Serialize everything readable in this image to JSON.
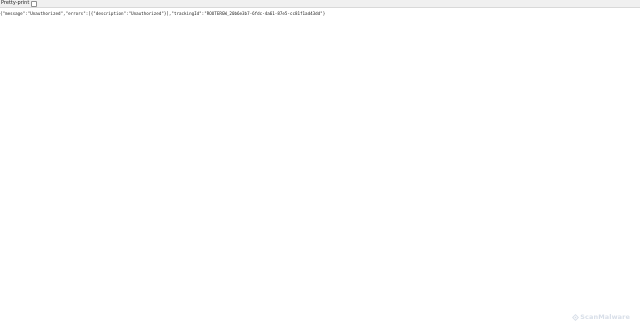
{
  "toolbar": {
    "pretty_print_label": "Pretty-print",
    "pretty_print_checked": false
  },
  "content": {
    "raw_json": "{\"message\":\"Unauthorized\",\"errors\":[{\"description\":\"Unauthorized\"}],\"trackingId\":\"ROUTERGW_20b6e3b7-6fdc-4a61-87e5-cc81f1ad43dd\"}"
  },
  "watermark": {
    "text": "ScanMalware",
    "icon": "scanmalware-logo-icon"
  },
  "colors": {
    "toolbar_bg": "#f0f0f0",
    "watermark": "#b8c4d6"
  }
}
